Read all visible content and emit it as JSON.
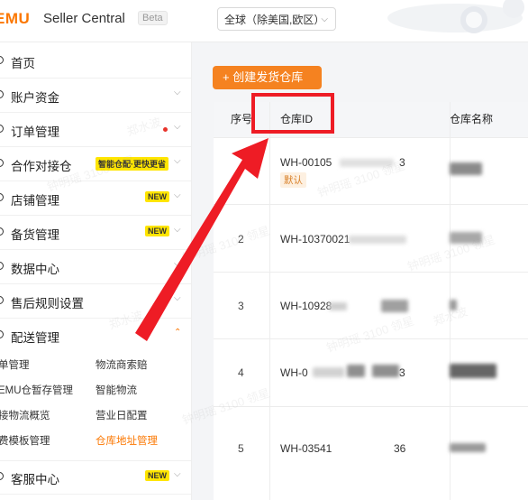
{
  "header": {
    "logo": "EMU",
    "app_name": "Seller Central",
    "badge": "Beta",
    "region_select": "全球（除美国,欧区）"
  },
  "sidebar": {
    "items": [
      {
        "label": "首页"
      },
      {
        "label": "账户资金"
      },
      {
        "label": "订单管理"
      },
      {
        "label": "合作对接仓",
        "tag": "智能仓配·更快更省"
      },
      {
        "label": "店铺管理",
        "tag": "NEW"
      },
      {
        "label": "备货管理",
        "tag": "NEW"
      },
      {
        "label": "数据中心"
      },
      {
        "label": "售后规则设置"
      },
      {
        "label": "配送管理"
      },
      {
        "label": "客服中心",
        "tag": "NEW"
      }
    ],
    "sub_items": [
      "单管理",
      "物流商索赔",
      "EMU仓暂存管理",
      "智能物流",
      "接物流概览",
      "营业日配置",
      "费模板管理",
      "仓库地址管理"
    ]
  },
  "main": {
    "create_button": "+ 创建发货仓库",
    "columns": [
      "序号",
      "仓库ID",
      "仓库名称"
    ],
    "rows": [
      {
        "index": "",
        "id": "WH-00105",
        "id_tail": "3",
        "tag": "默认"
      },
      {
        "index": "2",
        "id": "WH-10370021",
        "id_tail": ""
      },
      {
        "index": "3",
        "id": "WH-10928",
        "id_tail": ""
      },
      {
        "index": "4",
        "id": "WH-0",
        "id_tail": "3"
      },
      {
        "index": "5",
        "id": "WH-03541",
        "id_tail": "36"
      }
    ]
  },
  "watermark": {
    "texts": [
      "钟明瑶 3100 领星",
      "郑水波"
    ]
  },
  "annotation": {
    "color": "#ee1c25"
  }
}
